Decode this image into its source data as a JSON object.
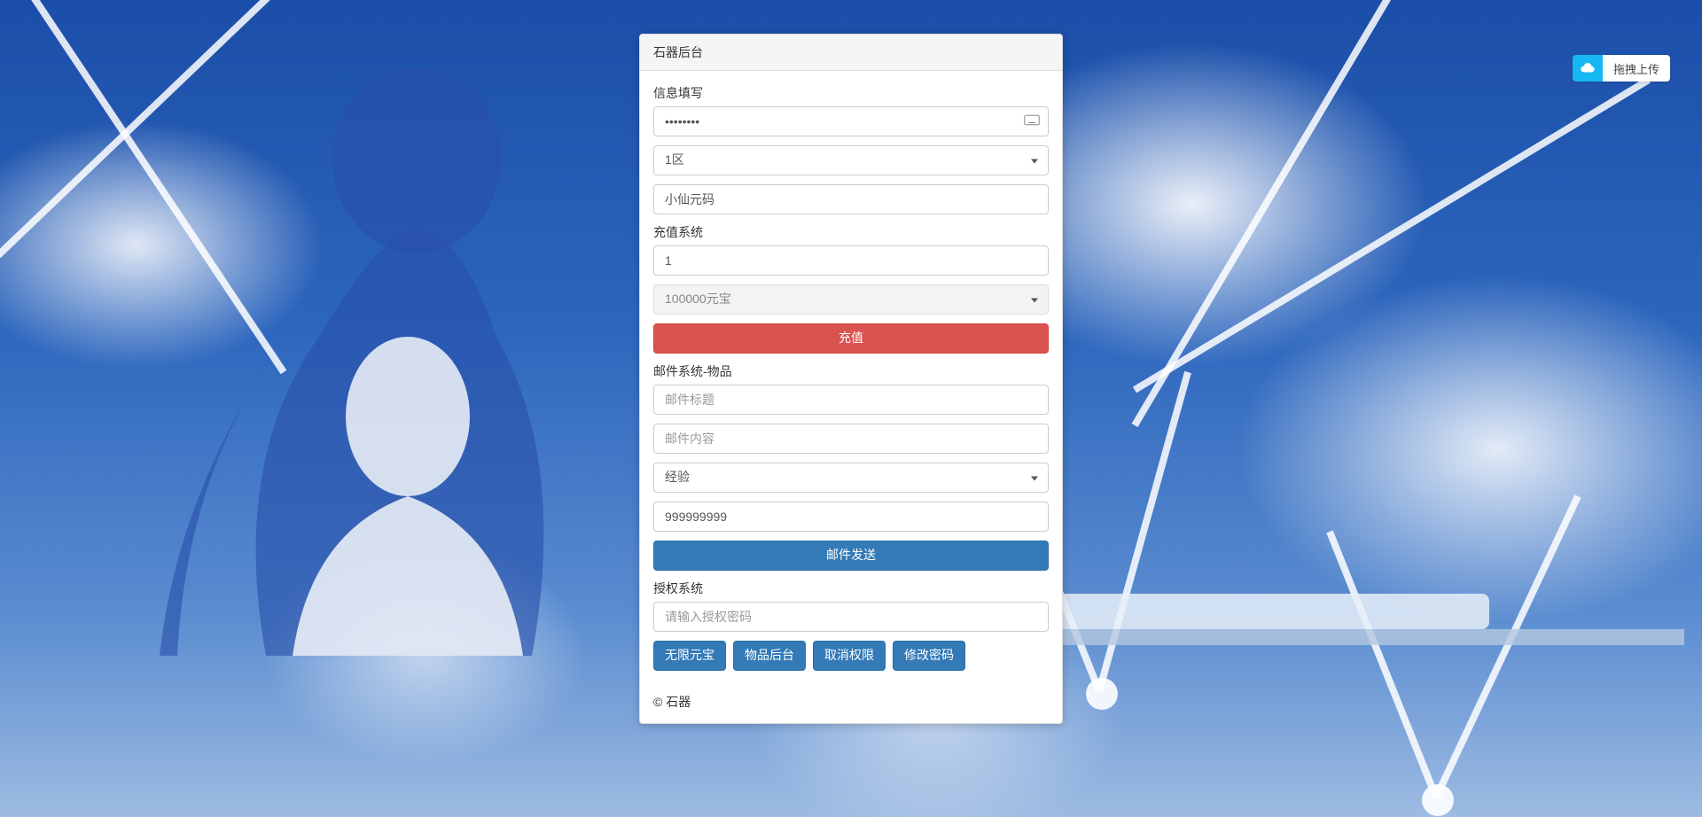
{
  "upload_widget": {
    "label": "拖拽上传"
  },
  "panel": {
    "title": "石器后台",
    "info_section": {
      "label": "信息填写",
      "password_value": "••••••••",
      "region_selected": "1区",
      "code_value": "小仙元码"
    },
    "recharge_section": {
      "label": "充值系统",
      "amount_value": "1",
      "option_selected": "100000元宝",
      "submit_label": "充值"
    },
    "mail_section": {
      "label": "邮件系统-物品",
      "title_placeholder": "邮件标题",
      "content_placeholder": "邮件内容",
      "type_selected": "经验",
      "quantity_value": "999999999",
      "submit_label": "邮件发送"
    },
    "auth_section": {
      "label": "授权系统",
      "password_placeholder": "请输入授权密码",
      "buttons": {
        "unlimited": "无限元宝",
        "item_admin": "物品后台",
        "revoke": "取消权限",
        "change_pw": "修改密码"
      }
    },
    "footer": "© 石器"
  }
}
